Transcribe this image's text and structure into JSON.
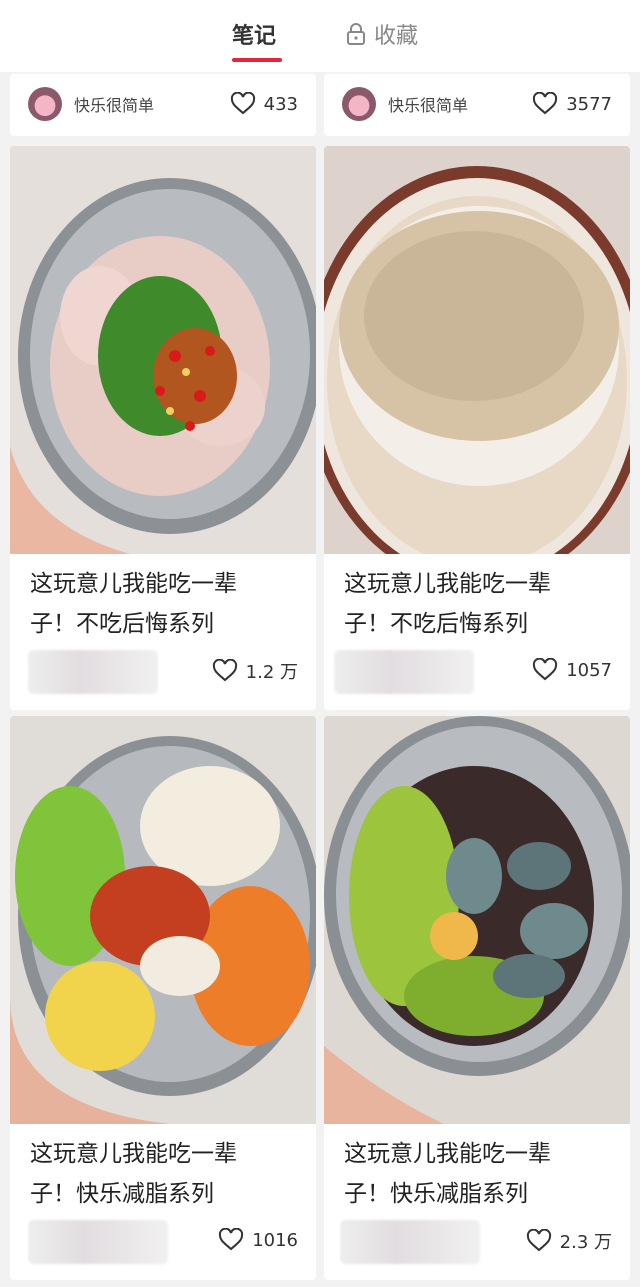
{
  "tabs": {
    "notes": "笔记",
    "favorites": "收藏",
    "lock_icon": "lock-icon"
  },
  "cards": [
    {
      "author": "快乐很简单",
      "likes": "433"
    },
    {
      "author": "快乐很简单",
      "likes": "3577"
    },
    {
      "title_line1": "这玩意儿我能吃一辈",
      "title_line2": "子！不吃后悔系列",
      "likes": "1.2 万"
    },
    {
      "title_line1": "这玩意儿我能吃一辈",
      "title_line2": "子！不吃后悔系列",
      "likes": "1057"
    },
    {
      "title_line1": "这玩意儿我能吃一辈",
      "title_line2": "子！快乐减脂系列",
      "likes": "1016"
    },
    {
      "title_line1": "这玩意儿我能吃一辈",
      "title_line2": "子！快乐减脂系列",
      "likes": "2.3 万"
    }
  ],
  "colors": {
    "accent": "#e8243a"
  }
}
